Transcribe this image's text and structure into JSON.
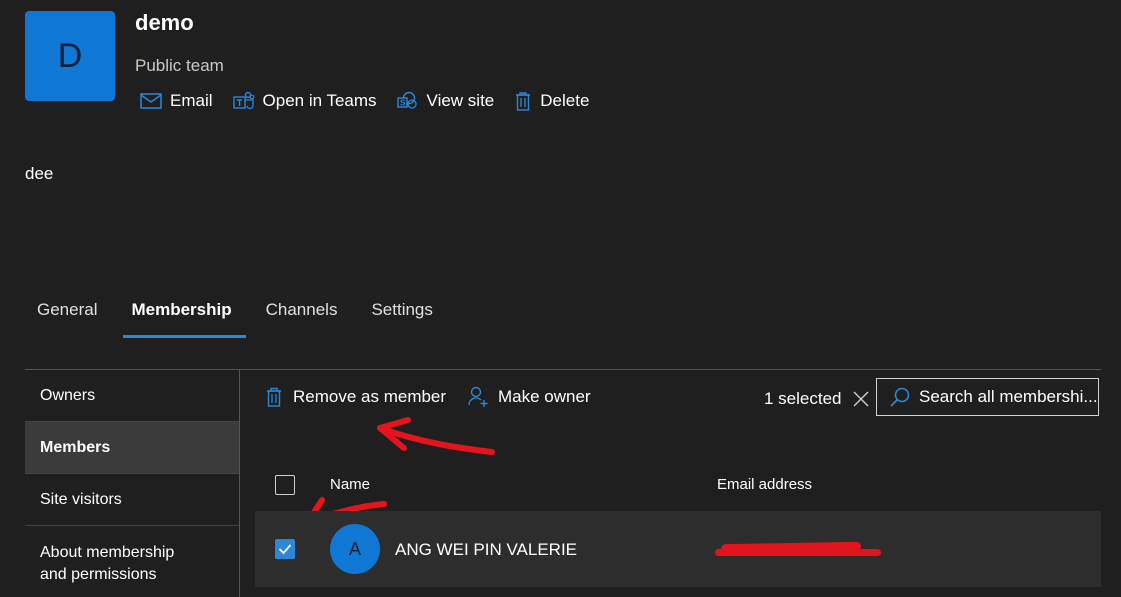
{
  "team": {
    "initial": "D",
    "name": "demo",
    "type": "Public team",
    "description": "dee"
  },
  "actions": {
    "email": "Email",
    "open_teams": "Open in Teams",
    "view_site": "View site",
    "delete": "Delete"
  },
  "tabs": [
    {
      "label": "General",
      "active": false
    },
    {
      "label": "Membership",
      "active": true
    },
    {
      "label": "Channels",
      "active": false
    },
    {
      "label": "Settings",
      "active": false
    }
  ],
  "sidebar": {
    "items": [
      {
        "label": "Owners"
      },
      {
        "label": "Members"
      },
      {
        "label": "Site visitors"
      },
      {
        "label": "About membership and permissions"
      }
    ]
  },
  "commands": {
    "remove": "Remove as member",
    "make_owner": "Make owner",
    "selected": "1 selected"
  },
  "search": {
    "placeholder": "Search all membershi..."
  },
  "table": {
    "columns": [
      "Name",
      "Email address"
    ],
    "rows": [
      {
        "initial": "A",
        "name": "ANG WEI PIN VALERIE",
        "checked": true
      }
    ]
  },
  "colors": {
    "accent": "#2b88d8",
    "avatar": "#0f78d4",
    "annotation": "#e4141c",
    "background": "#1f1f1f"
  }
}
